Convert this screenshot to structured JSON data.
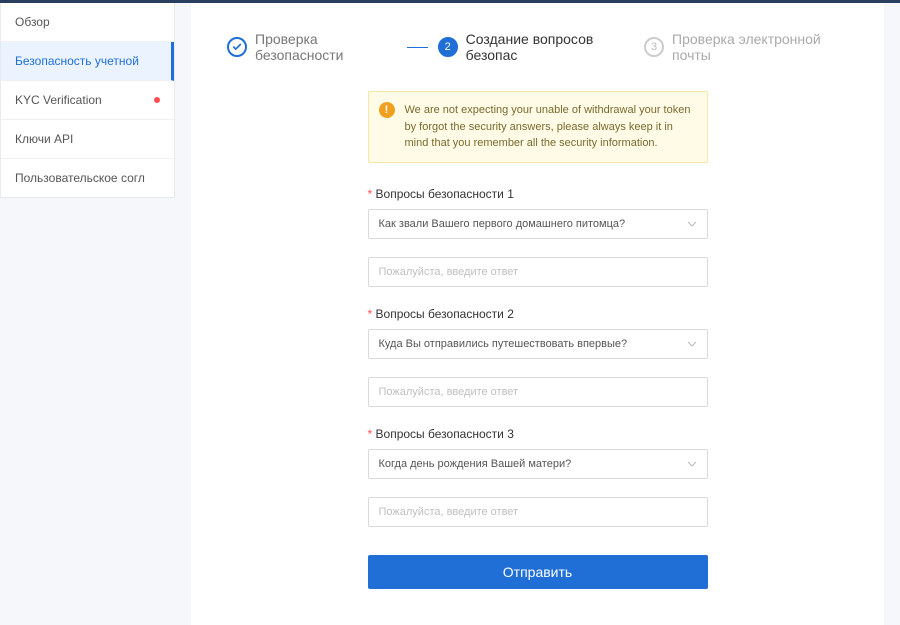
{
  "sidebar": {
    "items": [
      {
        "label": "Обзор"
      },
      {
        "label": "Безопасность учетной"
      },
      {
        "label": "KYC Verification"
      },
      {
        "label": "Ключи API"
      },
      {
        "label": "Пользовательское согл"
      }
    ]
  },
  "steps": {
    "s1": {
      "label": "Проверка безопасности"
    },
    "s2": {
      "num": "2",
      "label": "Создание вопросов безопас"
    },
    "s3": {
      "num": "3",
      "label": "Проверка электронной почты"
    }
  },
  "alert": {
    "text": "We are not expecting your unable of withdrawal your token by forgot the security answers, please always keep it in mind that you remember all the security information."
  },
  "questions": [
    {
      "label": "Вопросы безопасности 1",
      "selected": "Как звали Вашего первого домашнего питомца?",
      "placeholder": "Пожалуйста, введите ответ"
    },
    {
      "label": "Вопросы безопасности 2",
      "selected": "Куда Вы отправились путешествовать впервые?",
      "placeholder": "Пожалуйста, введите ответ"
    },
    {
      "label": "Вопросы безопасности 3",
      "selected": "Когда день рождения Вашей матери?",
      "placeholder": "Пожалуйста, введите ответ"
    }
  ],
  "submit_label": "Отправить"
}
